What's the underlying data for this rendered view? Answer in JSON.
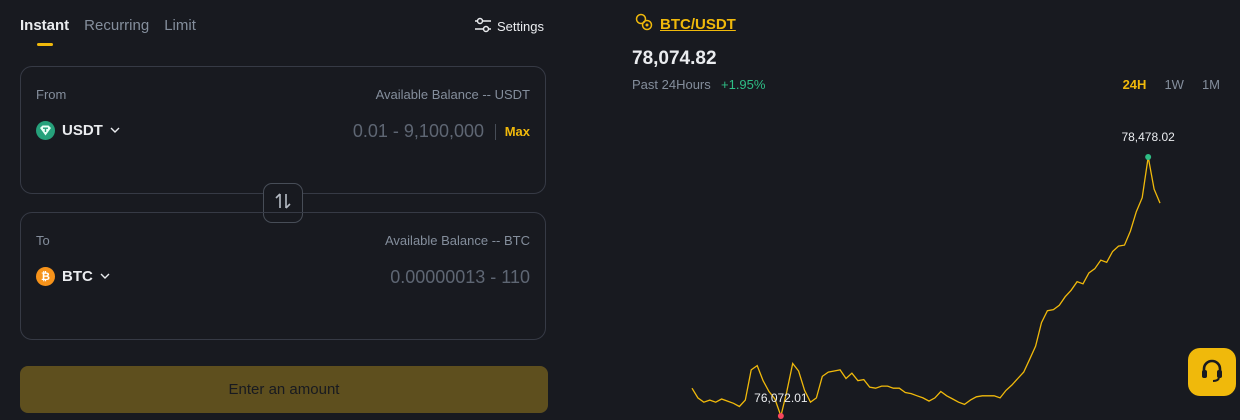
{
  "tabs": [
    {
      "label": "Instant",
      "active": true
    },
    {
      "label": "Recurring",
      "active": false
    },
    {
      "label": "Limit",
      "active": false
    }
  ],
  "settings_label": "Settings",
  "from": {
    "label": "From",
    "balance": "Available Balance -- USDT",
    "coin": "USDT",
    "coin_icon": "tether-icon",
    "range": "0.01 - 9,100,000",
    "max_label": "Max"
  },
  "to": {
    "label": "To",
    "balance": "Available Balance -- BTC",
    "coin": "BTC",
    "coin_icon": "bitcoin-icon",
    "range": "0.00000013 - 110"
  },
  "cta_label": "Enter an amount",
  "pair": "BTC/USDT",
  "price": "78,074.82",
  "period_label": "Past 24Hours",
  "change": "+1.95%",
  "ranges": [
    {
      "label": "24H",
      "active": true
    },
    {
      "label": "1W",
      "active": false
    },
    {
      "label": "1M",
      "active": false
    }
  ],
  "colors": {
    "accent": "#f0b90b",
    "positive": "#2ebd85",
    "negative": "#f6465d",
    "background": "#181a20"
  },
  "chart_data": {
    "type": "line",
    "high_label": "78,478.02",
    "low_label": "76,072.01",
    "high": 78478.02,
    "low": 76072.01,
    "values": [
      76330,
      76240,
      76200,
      76220,
      76200,
      76230,
      76210,
      76190,
      76160,
      76220,
      76500,
      76540,
      76400,
      76300,
      76230,
      76072.01,
      76300,
      76560,
      76490,
      76310,
      76200,
      76240,
      76440,
      76480,
      76490,
      76500,
      76420,
      76470,
      76400,
      76410,
      76340,
      76330,
      76350,
      76350,
      76330,
      76330,
      76290,
      76280,
      76260,
      76240,
      76210,
      76240,
      76300,
      76260,
      76230,
      76200,
      76180,
      76220,
      76250,
      76260,
      76260,
      76260,
      76240,
      76310,
      76360,
      76420,
      76480,
      76600,
      76720,
      76940,
      77050,
      77060,
      77100,
      77180,
      77240,
      77320,
      77300,
      77400,
      77440,
      77520,
      77500,
      77600,
      77650,
      77660,
      77790,
      77970,
      78100,
      78478.02,
      78180,
      78050
    ]
  }
}
